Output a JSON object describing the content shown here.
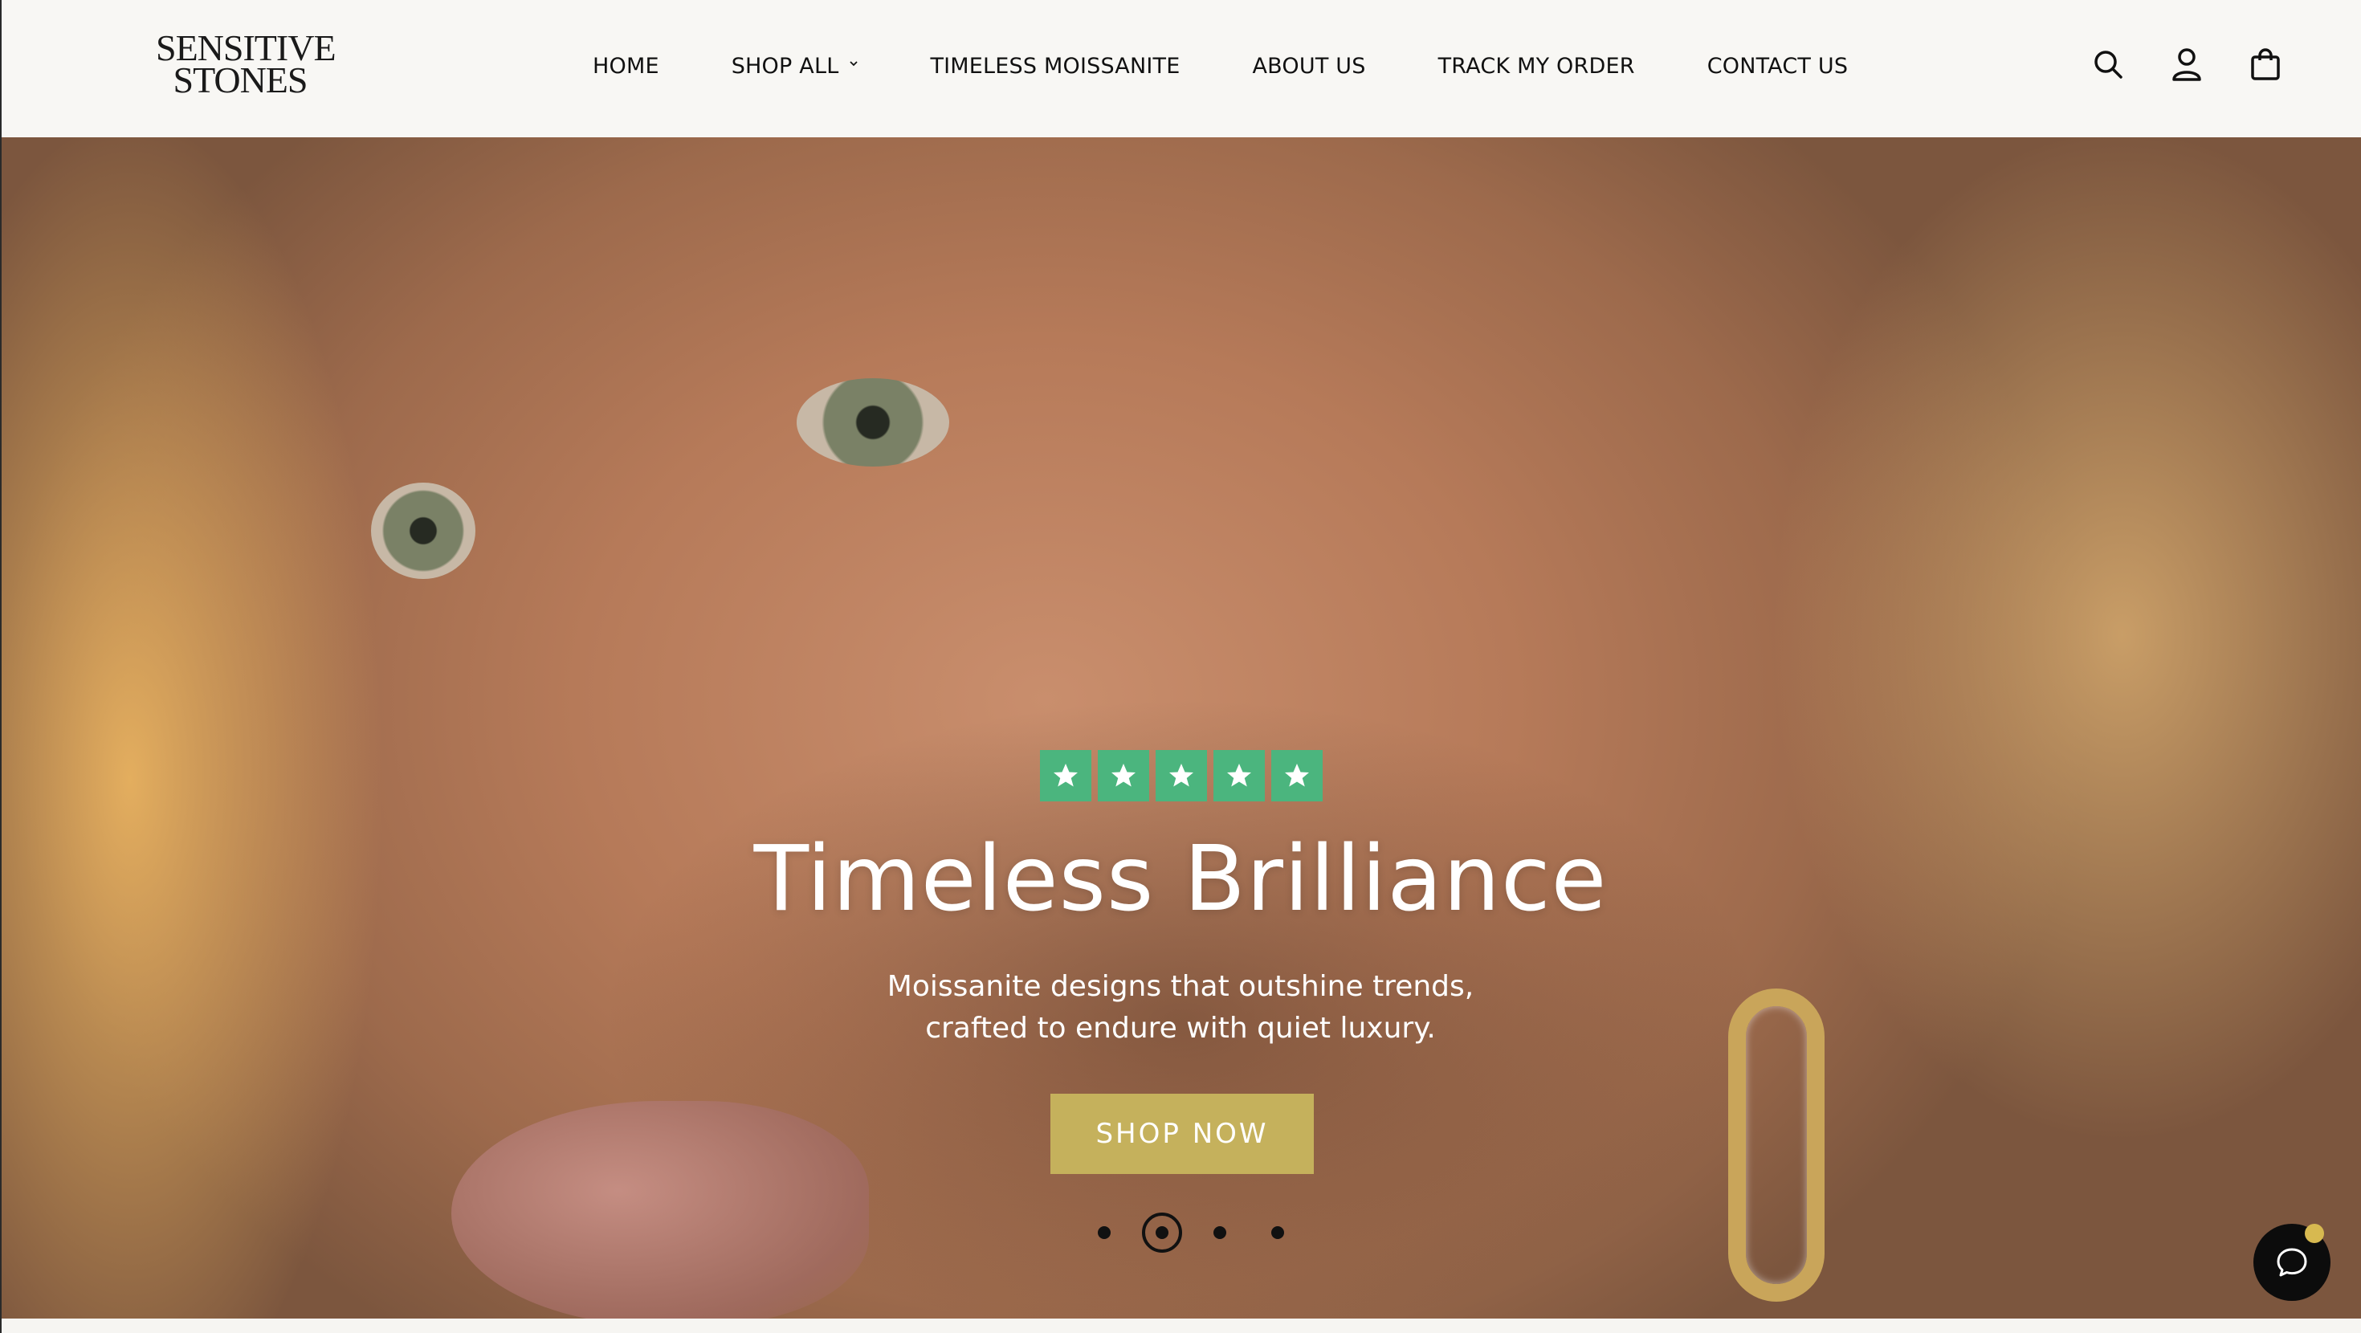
{
  "brand": {
    "logo_line1": "SENSITIVE",
    "logo_line2": "STONES"
  },
  "nav": {
    "items": [
      {
        "label": "HOME"
      },
      {
        "label": "SHOP ALL",
        "has_dropdown": true
      },
      {
        "label": "TIMELESS MOISSANITE"
      },
      {
        "label": "ABOUT US"
      },
      {
        "label": "TRACK MY ORDER"
      },
      {
        "label": "CONTACT US"
      }
    ]
  },
  "header_icons": [
    "search-icon",
    "account-icon",
    "cart-icon"
  ],
  "hero": {
    "rating_stars": 5,
    "headline": "Timeless Brilliance",
    "subtext_line1": "Moissanite designs that outshine trends,",
    "subtext_line2": "crafted to endure with quiet luxury.",
    "cta_label": "SHOP NOW",
    "slides_count": 4,
    "active_slide": 2
  },
  "colors": {
    "header_bg": "#f8f7f4",
    "star_green": "#4bb57e",
    "cta_gold": "#c5b15c",
    "chat_badge": "#d7b950",
    "text_dark": "#111111"
  }
}
